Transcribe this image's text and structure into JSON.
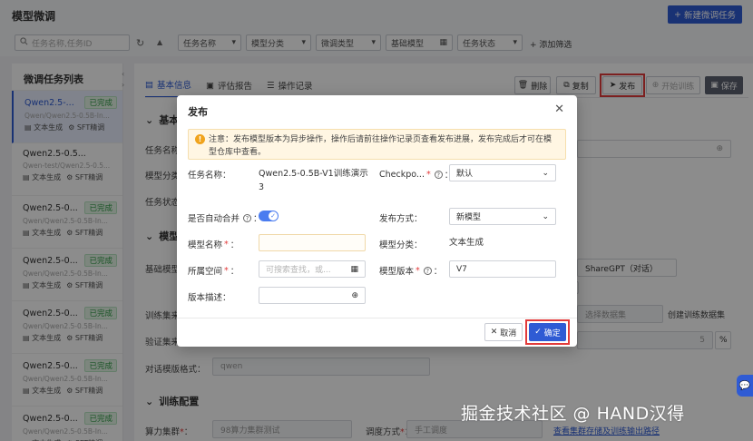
{
  "header": {
    "title": "模型微调",
    "new_task_label": "新建微调任务",
    "plus": "+"
  },
  "filters": {
    "search_placeholder": "任务名称,任务ID",
    "task_name": "任务名称",
    "model_category": "模型分类",
    "finetune_type": "微调类型",
    "base_model": "基础模型",
    "task_status": "任务状态",
    "add_filter": "+ 添加筛选"
  },
  "tasklist": {
    "title": "微调任务列表",
    "items": [
      {
        "name": "Qwen2.5-...",
        "status": "已完成",
        "sub": "Qwen/Qwen2.5-0.5B-In...",
        "tag1": "文本生成",
        "tag2": "SFT精调"
      },
      {
        "name": "Qwen2.5-0.5...",
        "status": "",
        "sub": "Qwen-test/Qwen2.5-0.5...",
        "tag1": "文本生成",
        "tag2": "SFT精调"
      },
      {
        "name": "Qwen2.5-0...",
        "status": "已完成",
        "sub": "Qwen/Qwen2.5-0.5B-In...",
        "tag1": "文本生成",
        "tag2": "SFT精调"
      },
      {
        "name": "Qwen2.5-0...",
        "status": "已完成",
        "sub": "Qwen/Qwen2.5-0.5B-In...",
        "tag1": "文本生成",
        "tag2": "SFT精调"
      },
      {
        "name": "Qwen2.5-0...",
        "status": "已完成",
        "sub": "Qwen/Qwen2.5-0.5B-In...",
        "tag1": "文本生成",
        "tag2": "SFT精调"
      },
      {
        "name": "Qwen2.5-0...",
        "status": "已完成",
        "sub": "Qwen/Qwen2.5-0.5B-In...",
        "tag1": "文本生成",
        "tag2": "SFT精调"
      },
      {
        "name": "Qwen2.5-0...",
        "status": "已完成",
        "sub": "Qwen/Qwen2.5-0.5B-In...",
        "tag1": "文本生成",
        "tag2": "SFT精调"
      }
    ]
  },
  "tabs": {
    "basic": "基本信息",
    "eval": "评估报告",
    "log": "操作记录"
  },
  "actions": {
    "delete": "删除",
    "copy": "复制",
    "publish": "发布",
    "start": "开始训练",
    "save": "保存"
  },
  "background": {
    "sec_basic": "基本",
    "task_name_label": "任务名称",
    "model_cat_label": "模型分类",
    "task_status_label": "任务状态",
    "sec_model": "模型",
    "base_model_label": "基础模型",
    "sharegpt": "ShareGPT（对话）",
    "train_set_label": "训练集来",
    "val_set_label": "验证集来",
    "val_value": "5",
    "percent": "%",
    "create_dataset": "创建训练数据集",
    "select_dataset_ph": "选择数据集",
    "chat_template_label": "对话模版格式：",
    "chat_template_value": "qwen",
    "sec_train": "训练配置",
    "cluster_label": "算力集群",
    "cluster_value": "98算力集群测试",
    "schedule_label": "调度方式",
    "schedule_value": "手工调度",
    "view_cluster_link": "查看集群存储及训练输出路径"
  },
  "modal": {
    "title": "发布",
    "notice": "注意：发布模型版本为异步操作，操作后请前往操作记录页查看发布进展，发布完成后才可在模型仓库中查看。",
    "task_name_label": "任务名称：",
    "task_name_value": "Qwen2.5-0.5B-V1训练演示3",
    "checkpoint_label": "Checkpo...",
    "checkpoint_value": "默认",
    "auto_merge_label": "是否自动合并",
    "publish_method_label": "发布方式：",
    "publish_method_value": "新模型",
    "model_name_label": "模型名称",
    "model_name_value": "",
    "model_category_label": "模型分类：",
    "model_category_value": "文本生成",
    "space_label": "所属空间",
    "space_placeholder": "可搜索查找，或...",
    "model_version_label": "模型版本",
    "model_version_value": "V7",
    "version_desc_label": "版本描述：",
    "version_desc_value": "",
    "cancel_label": "取消",
    "confirm_label": "确定"
  },
  "watermark": "掘金技术社区 @ HAND汉得"
}
